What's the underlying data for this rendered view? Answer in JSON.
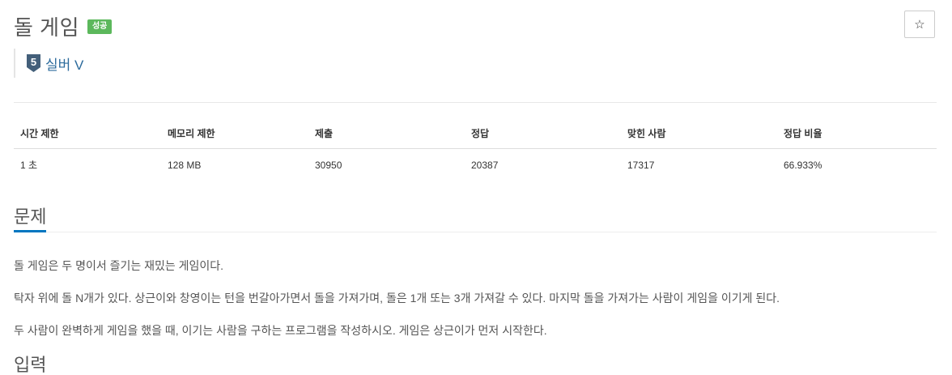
{
  "problem": {
    "title": "돌 게임",
    "status_badge": "성공",
    "star_icon": "☆",
    "tier": {
      "number": "5",
      "label": "실버 V",
      "color": "#435f7a"
    }
  },
  "stats": {
    "headers": [
      "시간 제한",
      "메모리 제한",
      "제출",
      "정답",
      "맞힌 사람",
      "정답 비율"
    ],
    "values": [
      "1 초",
      "128 MB",
      "30950",
      "20387",
      "17317",
      "66.933%"
    ]
  },
  "section": {
    "title": "문제",
    "paragraphs": [
      "돌 게임은 두 명이서 즐기는 재밌는 게임이다.",
      "탁자 위에 돌 N개가 있다. 상근이와 창영이는 턴을 번갈아가면서 돌을 가져가며, 돌은 1개 또는 3개 가져갈 수 있다. 마지막 돌을 가져가는 사람이 게임을 이기게 된다.",
      "두 사람이 완벽하게 게임을 했을 때, 이기는 사람을 구하는 프로그램을 작성하시오. 게임은 상근이가 먼저 시작한다."
    ],
    "next_heading": "입력"
  },
  "colors": {
    "accent": "#0076c0",
    "success": "#5cb85c",
    "tier_text": "#2c6b9c"
  }
}
